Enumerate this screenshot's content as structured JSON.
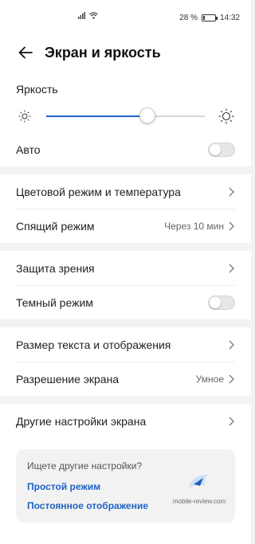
{
  "status": {
    "battery": "28 %",
    "time": "14:32",
    "battery_level": 0.28
  },
  "header": {
    "title": "Экран и яркость",
    "back_icon": "arrow-left-icon"
  },
  "brightness": {
    "title": "Яркость",
    "level": 0.64
  },
  "rows": {
    "auto": "Авто",
    "color_mode": "Цветовой режим и температура",
    "sleep": "Спящий режим",
    "sleep_value": "Через 10 мин",
    "eye_protection": "Защита зрения",
    "dark_mode": "Темный режим",
    "text_size": "Размер текста и отображения",
    "resolution": "Разрешение экрана",
    "resolution_value": "Умное",
    "other": "Другие настройки экрана"
  },
  "suggest": {
    "question": "Ищете другие настройки?",
    "link1": "Простой режим",
    "link2": "Постоянное отображение",
    "watermark": "mobile-review.com"
  },
  "colors": {
    "accent": "#1e63c5",
    "background": "#f1f3f5"
  }
}
